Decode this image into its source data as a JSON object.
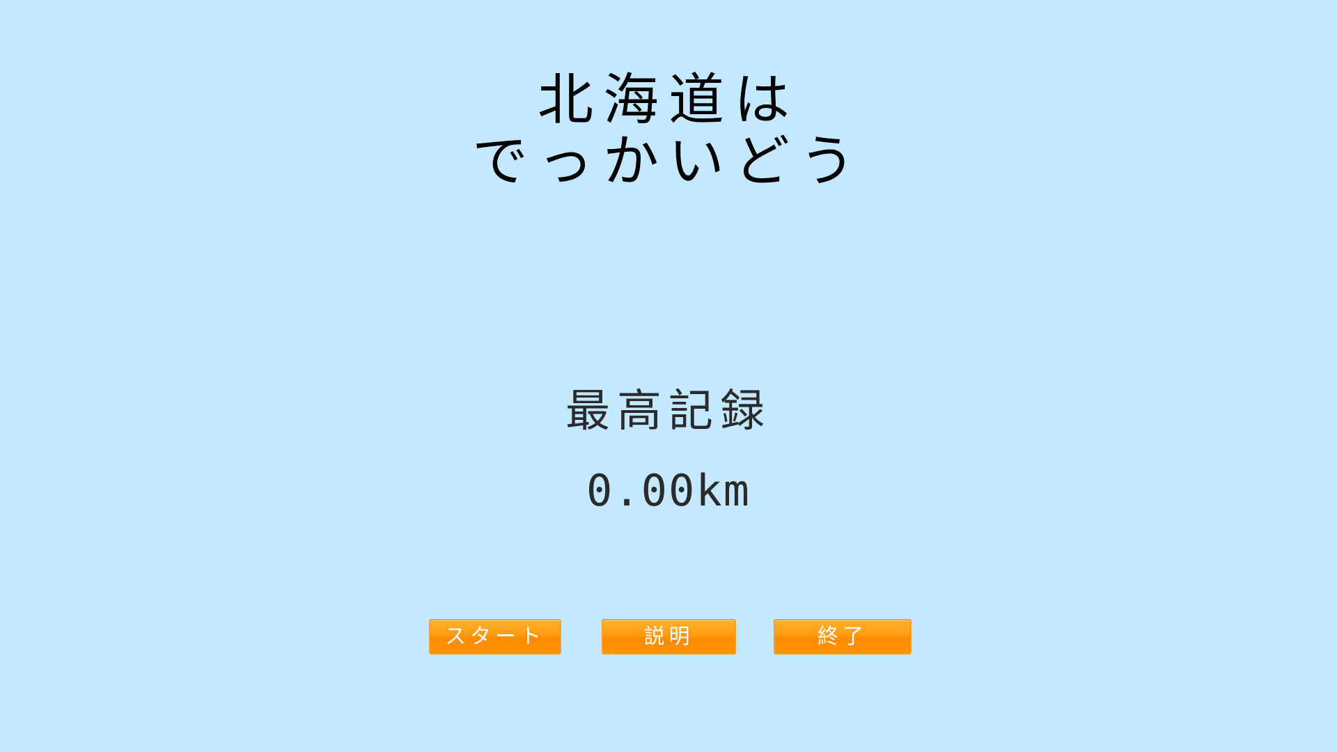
{
  "title": {
    "line1": "北海道は",
    "line2": "でっかいどう"
  },
  "record": {
    "label": "最高記録",
    "value": "0.00km"
  },
  "buttons": {
    "start": "スタート",
    "help": "説明",
    "quit": "終了"
  },
  "colors": {
    "background": "#c4e8ff",
    "button": "#ff9a10",
    "text": "#000000"
  }
}
